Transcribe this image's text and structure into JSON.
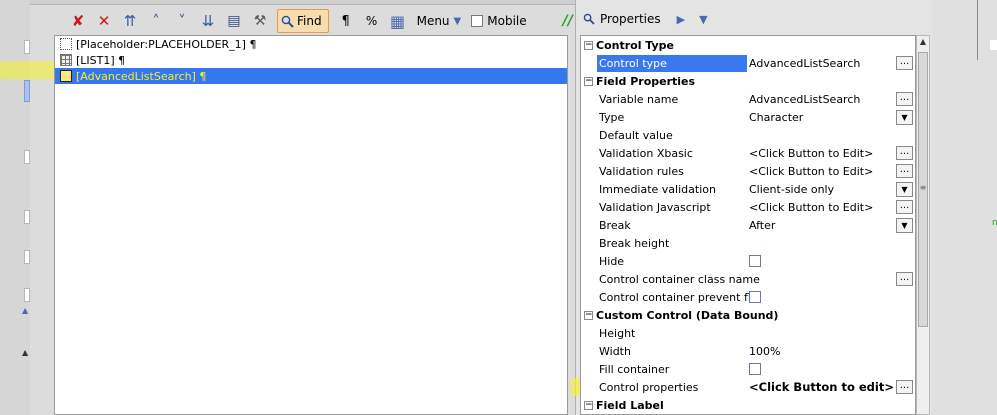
{
  "toolbar": {
    "find_label": "Find",
    "pilcrow": "¶",
    "percent": "%",
    "menu_label": "Menu",
    "mobile_label": "Mobile",
    "green_mark": "//"
  },
  "tree": {
    "items": [
      {
        "label": "[Placeholder:PLACEHOLDER_1] ¶",
        "icon": "placeholder-icon"
      },
      {
        "label": "[LIST1] ¶",
        "icon": "list-grid-icon"
      },
      {
        "label": "[AdvancedListSearch] ¶",
        "icon": "search-control-icon",
        "selected": true
      }
    ]
  },
  "properties_panel": {
    "title": "Properties",
    "sections": {
      "control_type": {
        "label": "Control Type",
        "rows": [
          {
            "name": "Control type",
            "value": "AdvancedListSearch"
          }
        ]
      },
      "field_properties": {
        "label": "Field Properties",
        "rows": [
          {
            "name": "Variable name",
            "value": "AdvancedListSearch"
          },
          {
            "name": "Type",
            "value": "Character"
          },
          {
            "name": "Default value",
            "value": ""
          },
          {
            "name": "Validation Xbasic",
            "value": "<Click Button to Edit>"
          },
          {
            "name": "Validation rules",
            "value": "<Click Button to Edit>"
          },
          {
            "name": "Immediate validation",
            "value": "Client-side only"
          },
          {
            "name": "Validation Javascript",
            "value": "<Click Button to Edit>"
          },
          {
            "name": "Break",
            "value": "After"
          },
          {
            "name": "Break height",
            "value": ""
          },
          {
            "name": "Hide",
            "value": ""
          },
          {
            "name": "Control container class name",
            "value": ""
          },
          {
            "name": "Control container prevent float",
            "value": ""
          }
        ]
      },
      "custom_control": {
        "label": "Custom Control (Data Bound)",
        "rows": [
          {
            "name": "Height",
            "value": ""
          },
          {
            "name": "Width",
            "value": "100%"
          },
          {
            "name": "Fill container",
            "value": ""
          },
          {
            "name": "Control properties",
            "value": "<Click Button to edit>"
          }
        ]
      },
      "field_label": {
        "label": "Field Label"
      }
    },
    "dots": "...",
    "collapse_glyph": "−"
  },
  "colors": {
    "selection_blue": "#3478f0",
    "highlight_yellow": "#f8f22a",
    "delete_red": "#d01818",
    "find_orange": "#f6dcae"
  }
}
